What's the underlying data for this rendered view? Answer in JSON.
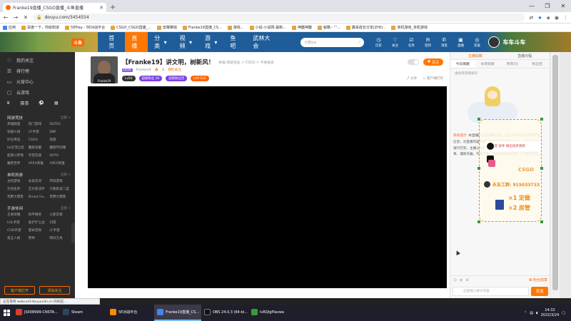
{
  "browser": {
    "tab_title": "Franke19直播_CSGO直播_斗鱼直播",
    "url": "douyu.com/3454554",
    "bookmarks": [
      "应用",
      "百度一下，你就知道",
      "5EPlay - 5E对战平台",
      "CSGO_CSGO直播_...",
      "去赚赚钱",
      "Franke19直播_CS...",
      "游戏...",
      "小说-小说网-最新...",
      "神器神器",
      "秘籍 - '''...",
      "鑫哥成长分享(ZHO...",
      "单机游戏_单机游戏"
    ]
  },
  "site": {
    "logo_badge": "斗鱼",
    "nav": [
      "首页",
      "直播",
      "分类",
      "视频",
      "游戏",
      "鱼吧",
      "武林大会"
    ],
    "search_placeholder": "大鹏bw",
    "header_icons": [
      "历史",
      "关注",
      "任务",
      "签到",
      "消息",
      "直播",
      "充值"
    ],
    "banner_text": "车车斗车"
  },
  "sidebar": {
    "items": [
      {
        "icon": "heart-icon",
        "label": "我的关注"
      },
      {
        "icon": "list-icon",
        "label": "排行榜"
      },
      {
        "icon": "video-icon",
        "label": "元宵中心"
      },
      {
        "icon": "gamepad-icon",
        "label": "云游戏"
      }
    ],
    "game_row": [
      "赛事"
    ],
    "sections": [
      {
        "title": "网游竞技",
        "more": "全部 >",
        "items": [
          "英雄联盟",
          "热门游戏",
          "DOTA2",
          "穿越火线",
          "CF手游",
          "DNF",
          "炉石传说",
          "CSGO",
          "逃跑",
          "lol云顶之弈",
          "魔兽争霸",
          "魔兽怀旧服",
          "超激斗梦境",
          "守望先锋",
          "DOTA",
          "魔兽世界",
          "APEX英雄",
          "APEX英雄"
        ]
      },
      {
        "title": "单机热游",
        "more": "全部 >",
        "items": [
          "主机游戏",
          "永劫无间",
          "怀旧游戏",
          "方舟生存",
          "艾尔登法环",
          "只狼影逝二度",
          "荒野大镖客",
          "Dread Hu...",
          "荒野大镖客"
        ]
      },
      {
        "title": "手游休闲",
        "more": "全部 >",
        "items": [
          "王者荣耀",
          "和平精英",
          "火影忍者",
          "LOL手游",
          "金铲铲之战",
          "幻塔",
          "COD手游",
          "使命召唤",
          "LF手游",
          "第五人格",
          "原神",
          "明日方舟"
        ]
      }
    ],
    "bottom_buttons": [
      "客户端打开",
      "添加关注"
    ]
  },
  "room": {
    "title": "【Franke19】讲文明，树新风！",
    "sub": "举报  网游竞技 > CSGO > 不想被说",
    "level": "LV16",
    "anchor": "Franke19",
    "fans": "6",
    "category": "我的关注",
    "anchor_name_short": "Franke19",
    "tags": [
      "Lv50",
      "超级粉丝 28",
      "超级粉丝团",
      "LV9 514"
    ],
    "follow_label": "关注",
    "share_label": "分享",
    "client_label": "客户端打开"
  },
  "chat": {
    "top": [
      "主播投稿",
      "直播日程"
    ],
    "tabs": [
      "今日贡献",
      "本周贡献",
      "贵宾(0)",
      "粉丝团"
    ],
    "empty": "虚拟贵宾榜展示",
    "notice_label": "系统提示:",
    "notice": "本直播间支持弹幕互动，禁止发布违法违规等不良信息，对直播内容有疑问请联系官方客服举报。严禁未成年人进行打赏，主播公开打赏，请大家注意理性消费。切勿私下交易，谨防诈骗，代练代刷，购买买卖账号或私下交易有风险。",
    "ad_slogan": "抖音 快手 微信同步更新",
    "ad_logo": "CSGO",
    "ad_qq": "永友工群: 915033733",
    "ad_price1": "×1 定做",
    "ad_price2": "×2 房管",
    "fan_label": "粉丝勋章",
    "input_placeholder": "这里输入聊天内容",
    "send_label": "发送"
  },
  "status": "正在等待 webconf.douyucdn.cn 的响应...",
  "taskbar": {
    "items": [
      {
        "label": "JS008999-CNSTA...",
        "color": "#d6402a"
      },
      {
        "label": "Steam",
        "color": "#2a475e"
      },
      {
        "label": "5E对战平台",
        "color": "#ff8a00"
      },
      {
        "label": "Franke19直播_CS...",
        "color": "#4285f4"
      },
      {
        "label": "OBS 24.0.3 (64-bi...",
        "color": "#111111"
      },
      {
        "label": "lvRQIgPlavwa",
        "color": "#3a9a3a"
      }
    ],
    "time": "14:32",
    "date": "2022/3/24"
  }
}
